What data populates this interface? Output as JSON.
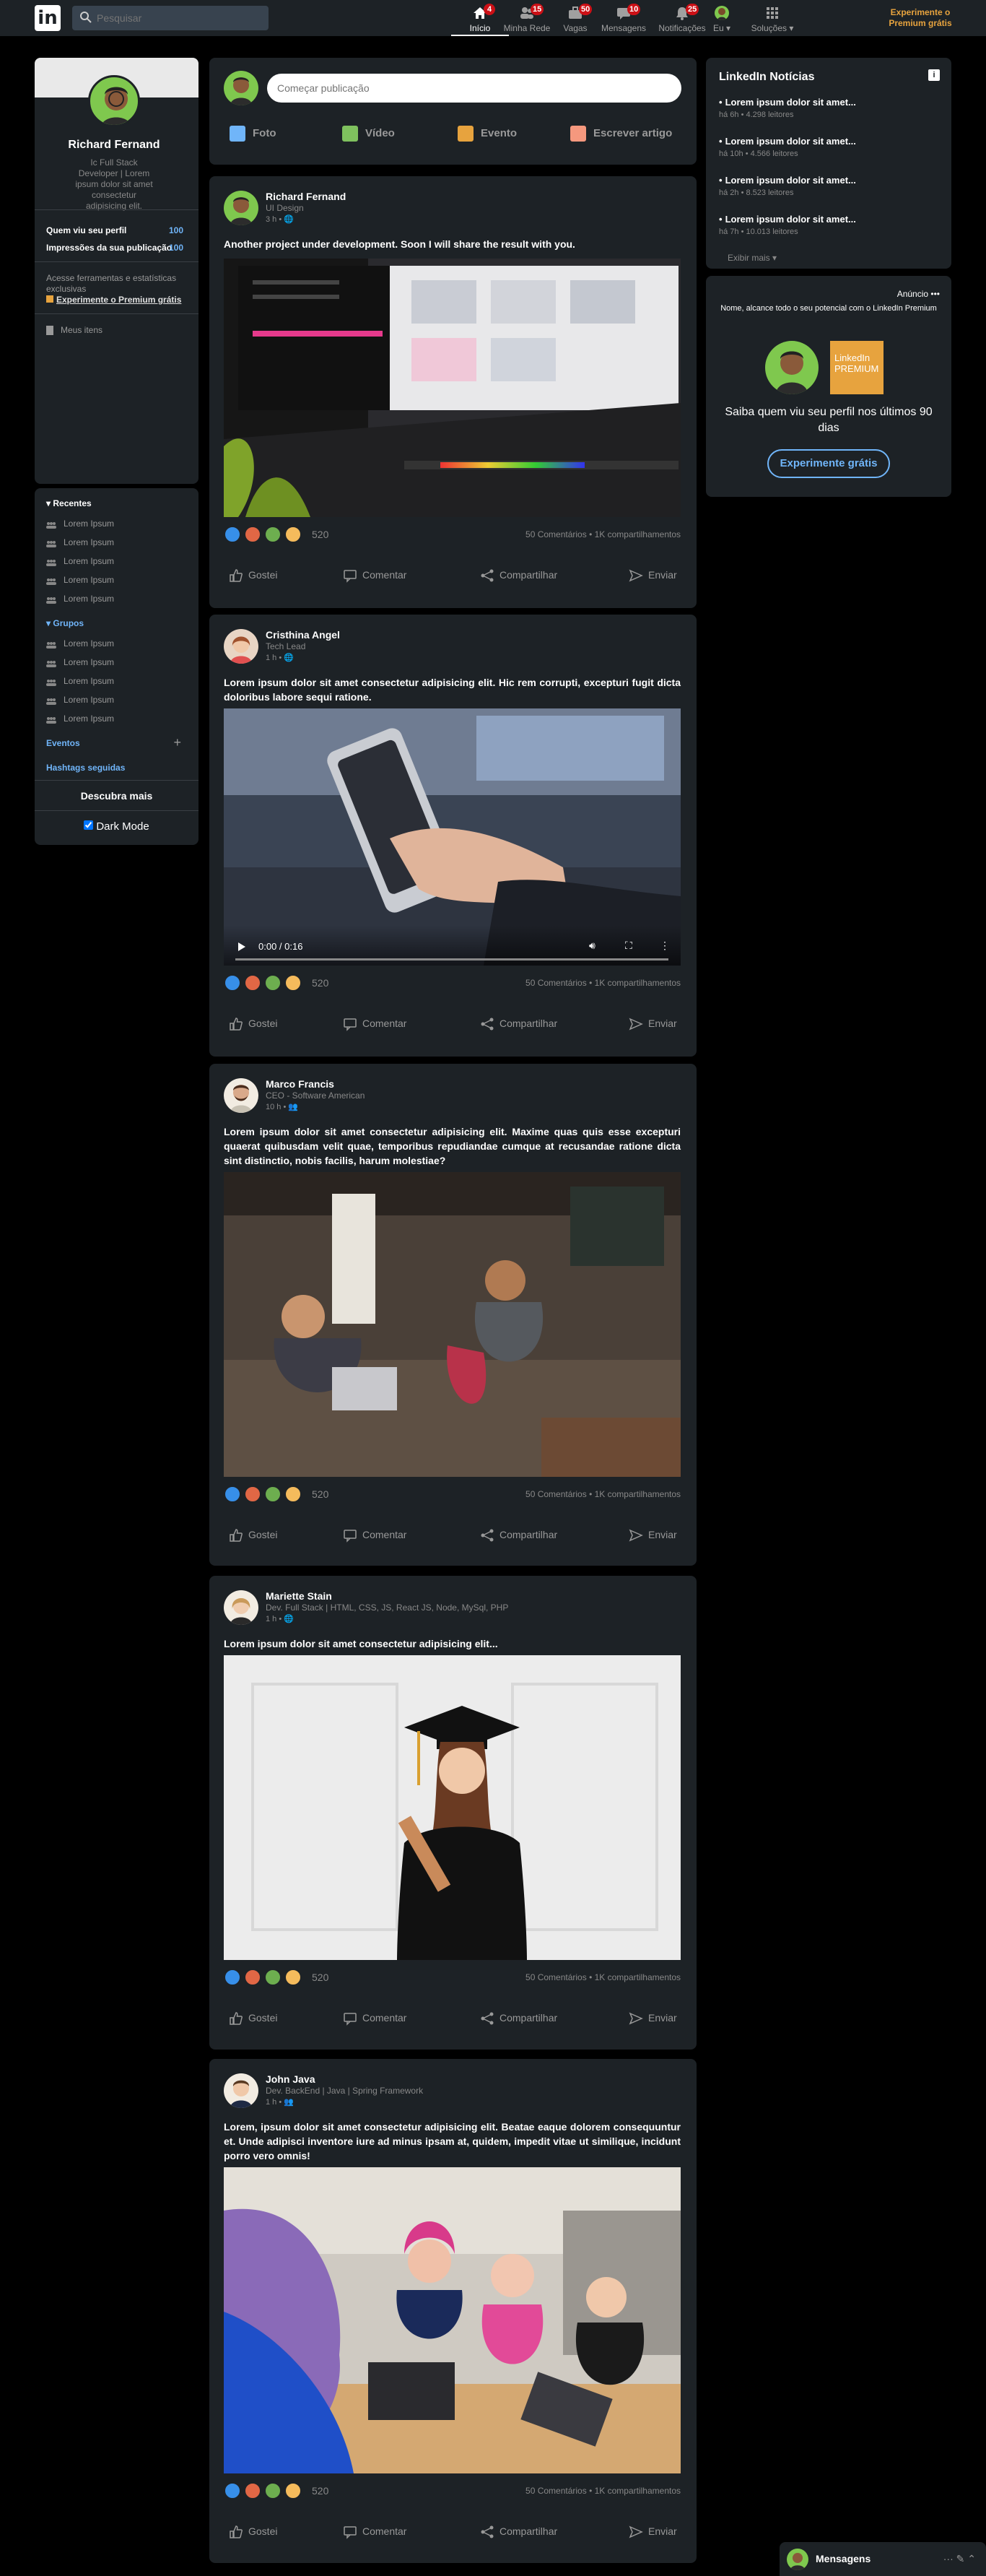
{
  "topbar": {
    "logo": "in",
    "search_placeholder": "Pesquisar",
    "nav": [
      {
        "label": "Início",
        "badge": "4",
        "icon": "home-icon"
      },
      {
        "label": "Minha Rede",
        "badge": "15",
        "icon": "network-icon"
      },
      {
        "label": "Vagas",
        "badge": "50",
        "icon": "jobs-icon"
      },
      {
        "label": "Mensagens",
        "badge": "10",
        "icon": "messaging-icon"
      },
      {
        "label": "Notificações",
        "badge": "25",
        "icon": "bell-icon"
      },
      {
        "label": "Eu ▾",
        "icon": "me-avatar"
      },
      {
        "label": "Soluções ▾",
        "icon": "grid-icon"
      }
    ],
    "premium": "Experimente o Premium grátis"
  },
  "profile": {
    "name": "Richard Fernand",
    "description": "Ic Full Stack Developer | Lorem ipsum dolor sit amet consectetur adipisicing elit.",
    "stats": [
      {
        "label": "Quem viu seu perfil",
        "value": "100"
      },
      {
        "label": "Impressões da sua publicação",
        "value": "100"
      }
    ],
    "premium_promo": "Acesse ferramentas e estatísticas exclusivas",
    "premium_link": "Experimente o Premium grátis",
    "my_items": "Meus itens"
  },
  "sidebar": {
    "recent_title": "▾ Recentes",
    "recent_items": [
      "Lorem Ipsum",
      "Lorem Ipsum",
      "Lorem Ipsum",
      "Lorem Ipsum",
      "Lorem Ipsum"
    ],
    "groups_title": "▾ Grupos",
    "group_items": [
      "Lorem Ipsum",
      "Lorem Ipsum",
      "Lorem Ipsum",
      "Lorem Ipsum",
      "Lorem Ipsum"
    ],
    "events": "Eventos",
    "hashtags": "Hashtags seguidas",
    "discover": "Descubra mais",
    "dark_mode": "Dark Mode"
  },
  "new_post": {
    "placeholder": "Começar publicação",
    "buttons": [
      "Foto",
      "Vídeo",
      "Evento",
      "Escrever artigo"
    ]
  },
  "posts": [
    {
      "author": "Richard Fernand",
      "role": "UI Design",
      "time": "3 h • 🌐",
      "text": "Another project under development. Soon I will share the result with you.",
      "reactions": "520",
      "comments": "50 Comentários",
      "shares": "1K compartilhamentos"
    },
    {
      "author": "Cristhina Angel",
      "role": "Tech Lead",
      "time": "1 h • 🌐",
      "text": "Lorem ipsum dolor sit amet consectetur adipisicing elit. Hic rem corrupti, excepturi fugit dicta doloribus labore sequi ratione.",
      "reactions": "520",
      "comments": "50 Comentários",
      "shares": "1K compartilhamentos",
      "video_time": "0:00 / 0:16"
    },
    {
      "author": "Marco Francis",
      "role": "CEO - Software American",
      "time": "10 h • 👥",
      "text": "Lorem ipsum dolor sit amet consectetur adipisicing elit. Maxime quas quis esse excepturi quaerat quibusdam velit quae, temporibus repudiandae cumque at recusandae ratione dicta sint distinctio, nobis facilis, harum molestiae?",
      "reactions": "520",
      "comments": "50 Comentários",
      "shares": "1K compartilhamentos"
    },
    {
      "author": "Mariette Stain",
      "role": "Dev. Full Stack | HTML, CSS, JS, React JS, Node, MySql, PHP",
      "time": "1 h • 🌐",
      "text": "Lorem ipsum dolor sit amet consectetur adipisicing elit...",
      "reactions": "520",
      "comments": "50 Comentários",
      "shares": "1K compartilhamentos"
    },
    {
      "author": "John Java",
      "role": "Dev. BackEnd | Java | Spring Framework",
      "time": "1 h • 👥",
      "text": "Lorem, ipsum dolor sit amet consectetur adipisicing elit. Beatae eaque dolorem consequuntur et. Unde adipisci inventore iure ad minus ipsam at, quidem, impedit vitae ut similique, incidunt porro vero omnis!",
      "reactions": "520",
      "comments": "50 Comentários",
      "shares": "1K compartilhamentos"
    }
  ],
  "post_actions": [
    "Gostei",
    "Comentar",
    "Compartilhar",
    "Enviar"
  ],
  "news": {
    "title": "LinkedIn Notícias",
    "info": "i",
    "items": [
      {
        "title": "Lorem ipsum dolor sit amet...",
        "meta": "há 6h • 4.298 leitores"
      },
      {
        "title": "Lorem ipsum dolor sit amet...",
        "meta": "há 10h • 4.566 leitores"
      },
      {
        "title": "Lorem ipsum dolor sit amet...",
        "meta": "há 2h • 8.523 leitores"
      },
      {
        "title": "Lorem ipsum dolor sit amet...",
        "meta": "há 7h • 10.013 leitores"
      }
    ],
    "more": "Exibir mais ▾"
  },
  "ad": {
    "label": "Anúncio •••",
    "text": "Nome, alcance todo o seu potencial com o LinkedIn Premium",
    "premium_badge": "LinkedIn PREMIUM",
    "headline": "Saiba quem viu seu perfil nos últimos 90 dias",
    "button": "Experimente grátis"
  },
  "messaging": {
    "label": "Mensagens",
    "controls": "··· ✎ ⌃"
  },
  "colors": {
    "background": "#000000",
    "card": "#1d2226",
    "accent_blue": "#70b5f9",
    "premium_gold": "#e7a33e",
    "badge_red": "#cc1016"
  }
}
